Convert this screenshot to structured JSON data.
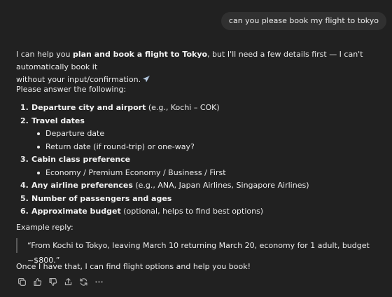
{
  "user_message": "can you please book my flight to tokyo",
  "reply": {
    "intro_pre": "I can help you ",
    "intro_bold": "plan and book a flight to Tokyo",
    "intro_post": ", but I'll need a few details first — I can't automatically book it",
    "intro_line2": "without your input/confirmation.",
    "ask": "Please answer the following:",
    "items": [
      {
        "num": "1.",
        "bold": "Departure city and airport",
        "rest": " (e.g., Kochi – COK)"
      },
      {
        "num": "2.",
        "bold": "Travel dates",
        "rest": ""
      },
      {
        "num": "3.",
        "bold": "Cabin class preference",
        "rest": ""
      },
      {
        "num": "4.",
        "bold": "Any airline preferences",
        "rest": " (e.g., ANA, Japan Airlines, Singapore Airlines)"
      },
      {
        "num": "5.",
        "bold": "Number of passengers and ages",
        "rest": ""
      },
      {
        "num": "6.",
        "bold": "Approximate budget",
        "rest": " (optional, helps to find best options)"
      }
    ],
    "travel_dates_sub": [
      "Departure date",
      "Return date (if round-trip) or one-way?"
    ],
    "cabin_sub": [
      "Economy / Premium Economy / Business / First"
    ],
    "example_label": "Example reply:",
    "example_quote": "“From Kochi to Tokyo, leaving March 10 returning March 20, economy for 1 adult, budget ~$800.”",
    "closing": "Once I have that, I can find flight options and help you book!"
  },
  "actions": {
    "copy": "copy-icon",
    "like": "thumbs-up-icon",
    "dislike": "thumbs-down-icon",
    "share": "share-icon",
    "regenerate": "regenerate-icon",
    "more": "more-icon"
  }
}
